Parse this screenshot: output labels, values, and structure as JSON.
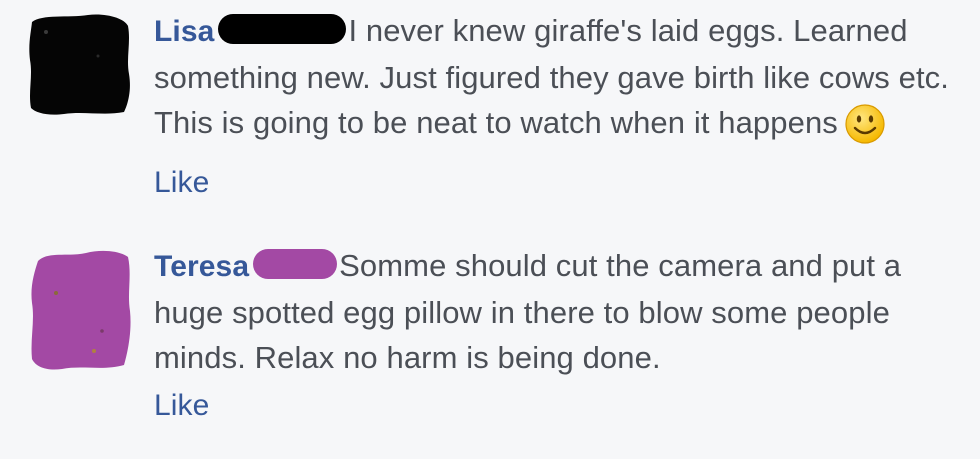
{
  "comments": [
    {
      "author": "Lisa",
      "text": "I never knew giraffe's laid eggs. Learned something new. Just figured they gave birth like cows etc. This is going to be neat to watch when it happens",
      "has_smiley": true,
      "redaction_color": "#000000",
      "like_label": "Like"
    },
    {
      "author": "Teresa",
      "text": "Somme should cut the camera and put a huge spotted egg pillow in there to blow some people minds. Relax no harm is being done.",
      "has_smiley": false,
      "redaction_color": "#a349a4",
      "like_label": "Like"
    }
  ],
  "colors": {
    "link": "#365899",
    "text": "#4b4f56",
    "background": "#f6f7f9"
  },
  "icons": {
    "smiley": "smiley-emoji-icon"
  }
}
